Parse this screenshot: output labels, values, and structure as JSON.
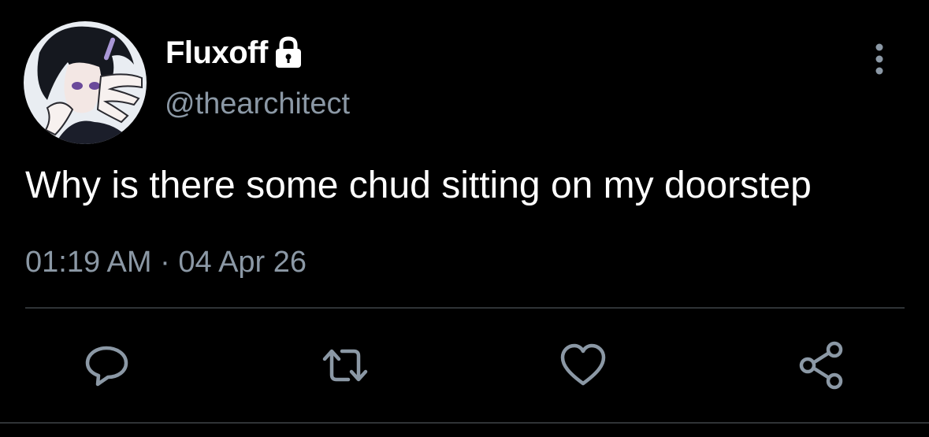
{
  "tweet": {
    "display_name": "Fluxoff",
    "handle": "@thearchitect",
    "protected_icon": "lock-icon",
    "text": "Why is there some chud sitting on my doorstep",
    "time": "01:19 AM",
    "separator": "·",
    "date": "04 Apr 26"
  },
  "actions": [
    {
      "name": "reply",
      "icon": "speech-bubble-icon"
    },
    {
      "name": "retweet",
      "icon": "retweet-arrows-icon"
    },
    {
      "name": "like",
      "icon": "heart-icon"
    },
    {
      "name": "share",
      "icon": "share-nodes-icon"
    }
  ],
  "menu_icon": "vertical-ellipsis-icon",
  "colors": {
    "background": "#000000",
    "primary_text": "#ffffff",
    "secondary_text": "#8b98a5",
    "divider": "#2f3336"
  }
}
